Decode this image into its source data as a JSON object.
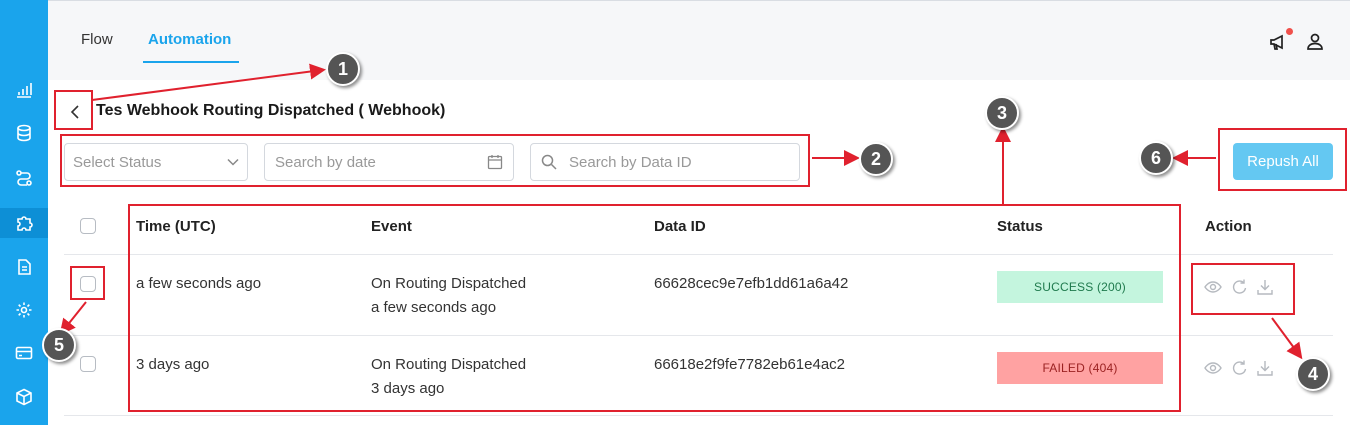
{
  "nav": {
    "tabs": [
      {
        "label": "Flow"
      },
      {
        "label": "Automation",
        "active": true
      }
    ]
  },
  "sidebar": {
    "icons": [
      "chart-icon",
      "database-icon",
      "flow-icon",
      "puzzle-icon",
      "document-icon",
      "gear-icon",
      "credit-card-icon",
      "cube-icon"
    ],
    "active_index": 3
  },
  "page": {
    "title": "Tes Webhook Routing Dispatched ( Webhook)"
  },
  "filters": {
    "status_placeholder": "Select Status",
    "date_placeholder": "Search by date",
    "data_id_placeholder": "Search by Data ID"
  },
  "actions": {
    "repush_all": "Repush All"
  },
  "table": {
    "headers": {
      "time": "Time (UTC)",
      "event": "Event",
      "data_id": "Data ID",
      "status": "Status",
      "action": "Action"
    },
    "rows": [
      {
        "time": "a few seconds ago",
        "event": "On Routing Dispatched",
        "event_time": "a few seconds ago",
        "data_id": "66628cec9e7efb1dd61a6a42",
        "status": "SUCCESS (200)"
      },
      {
        "time": "3 days ago",
        "event": "On Routing Dispatched",
        "event_time": "3 days ago",
        "data_id": "66618e2f9fe7782eb61e4ac2",
        "status": "FAILED (404)"
      }
    ]
  },
  "annotations": {
    "callouts": [
      "1",
      "2",
      "3",
      "4",
      "5",
      "6"
    ]
  },
  "colors": {
    "accent": "#1aa4ec",
    "repush": "#64c8f2",
    "success_bg": "#c4f5de",
    "failed_bg": "#ffa2a2",
    "annotation_red": "#e0212e"
  }
}
